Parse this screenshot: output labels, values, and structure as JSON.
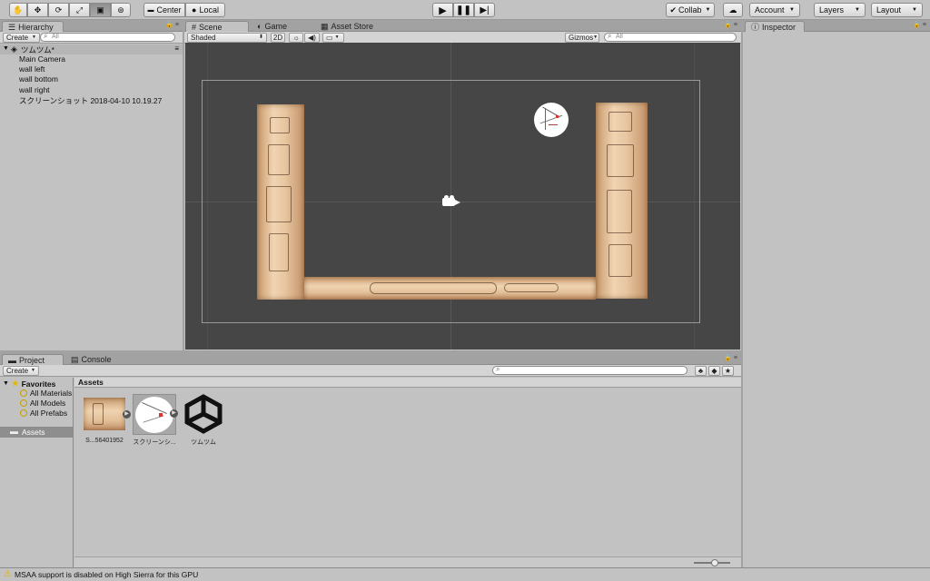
{
  "toolbar": {
    "transform_tools": [
      "hand-tool-icon",
      "move-tool-icon",
      "rotate-tool-icon",
      "scale-tool-icon",
      "rect-tool-icon",
      "transform-tool-icon"
    ],
    "pivot_label": "Center",
    "space_label": "Local",
    "collab_label": "Collab",
    "account_label": "Account",
    "layers_label": "Layers",
    "layout_label": "Layout"
  },
  "hierarchy": {
    "tab_label": "Hierarchy",
    "create_label": "Create",
    "search_placeholder": "All",
    "scene_name": "ツムツム*",
    "items": [
      "Main Camera",
      "wall left",
      "wall bottom",
      "wall right",
      "スクリーンショット 2018-04-10 10.19.27"
    ]
  },
  "scene": {
    "tabs": [
      "Scene",
      "Game",
      "Asset Store"
    ],
    "shading_mode": "Shaded",
    "mode_2d_label": "2D",
    "gizmos_label": "Gizmos",
    "search_placeholder": "All"
  },
  "inspector": {
    "tab_label": "Inspector"
  },
  "project": {
    "tabs": [
      "Project",
      "Console"
    ],
    "create_label": "Create",
    "favorites_label": "Favorites",
    "favorites": [
      "All Materials",
      "All Models",
      "All Prefabs"
    ],
    "assets_folder": "Assets",
    "breadcrumb": "Assets",
    "assets": [
      "S...56401952",
      "スクリーンシ...",
      "ツムツム"
    ]
  },
  "status": {
    "message": "MSAA support is disabled on High Sierra for this GPU"
  },
  "colors": {
    "scene_bg": "#464646",
    "panel_bg": "#c2c2c2",
    "selection": "#8e8e8e"
  }
}
